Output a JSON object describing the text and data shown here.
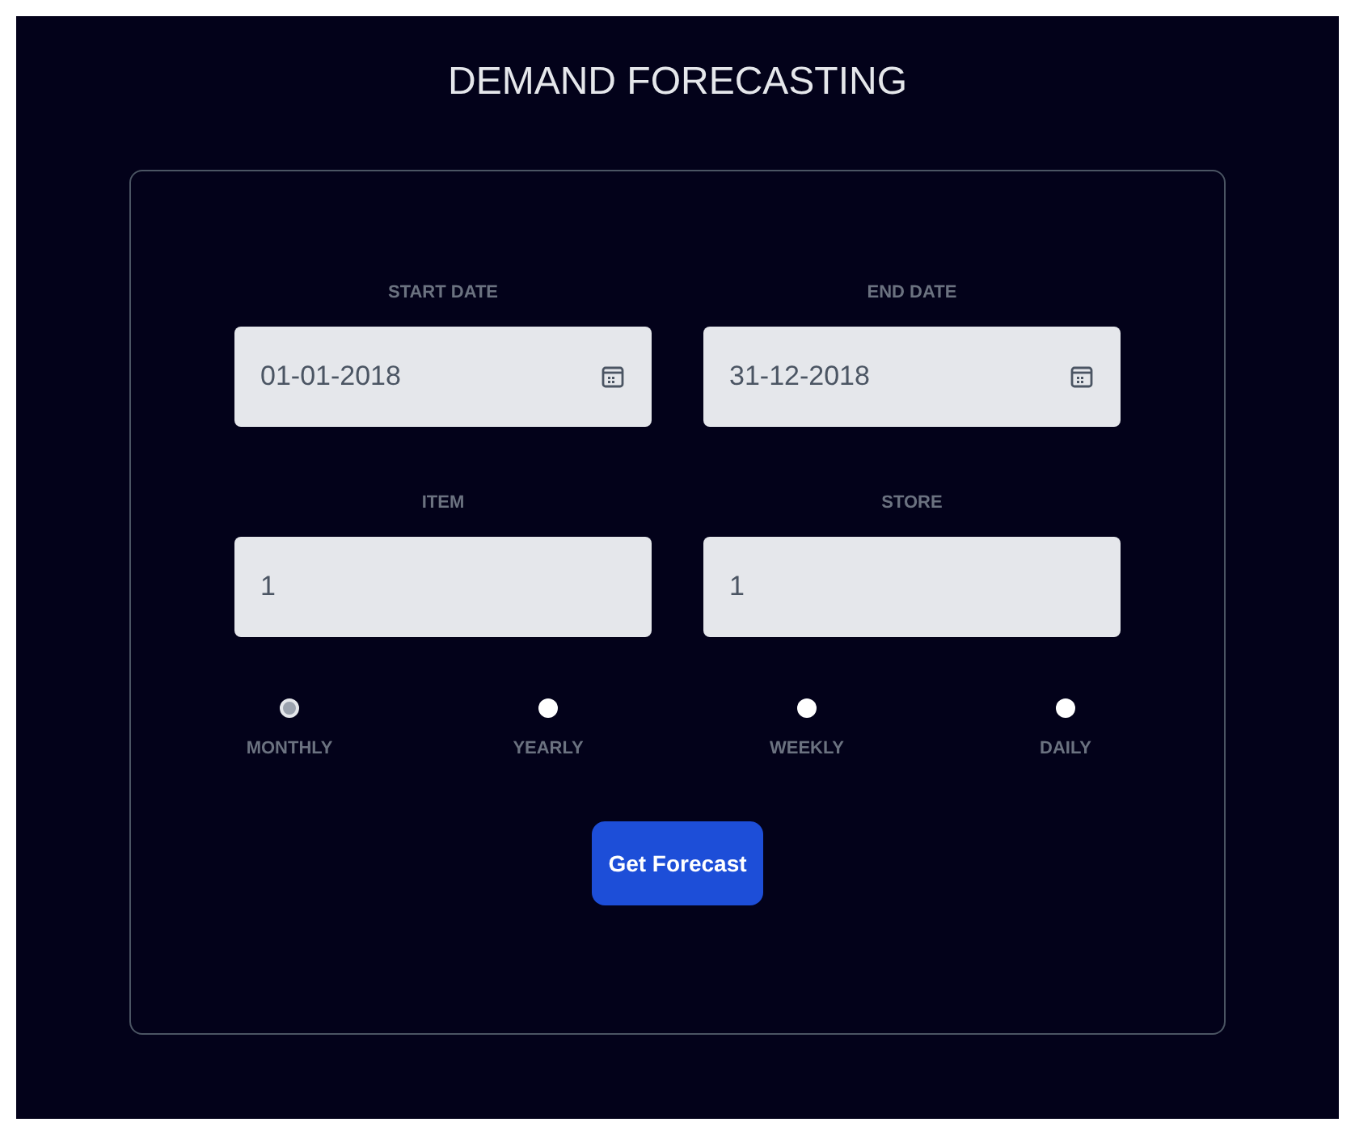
{
  "title": "DEMAND FORECASTING",
  "fields": [
    {
      "label": "START DATE",
      "value": "01-01-2018",
      "kind": "date"
    },
    {
      "label": "END DATE",
      "value": "31-12-2018",
      "kind": "date"
    },
    {
      "label": "ITEM",
      "value": "1",
      "kind": "number"
    },
    {
      "label": "STORE",
      "value": "1",
      "kind": "number"
    }
  ],
  "frequencies": [
    {
      "label": "MONTHLY",
      "selected": true
    },
    {
      "label": "YEARLY",
      "selected": false
    },
    {
      "label": "WEEKLY",
      "selected": false
    },
    {
      "label": "DAILY",
      "selected": false
    }
  ],
  "button": "Get Forecast"
}
